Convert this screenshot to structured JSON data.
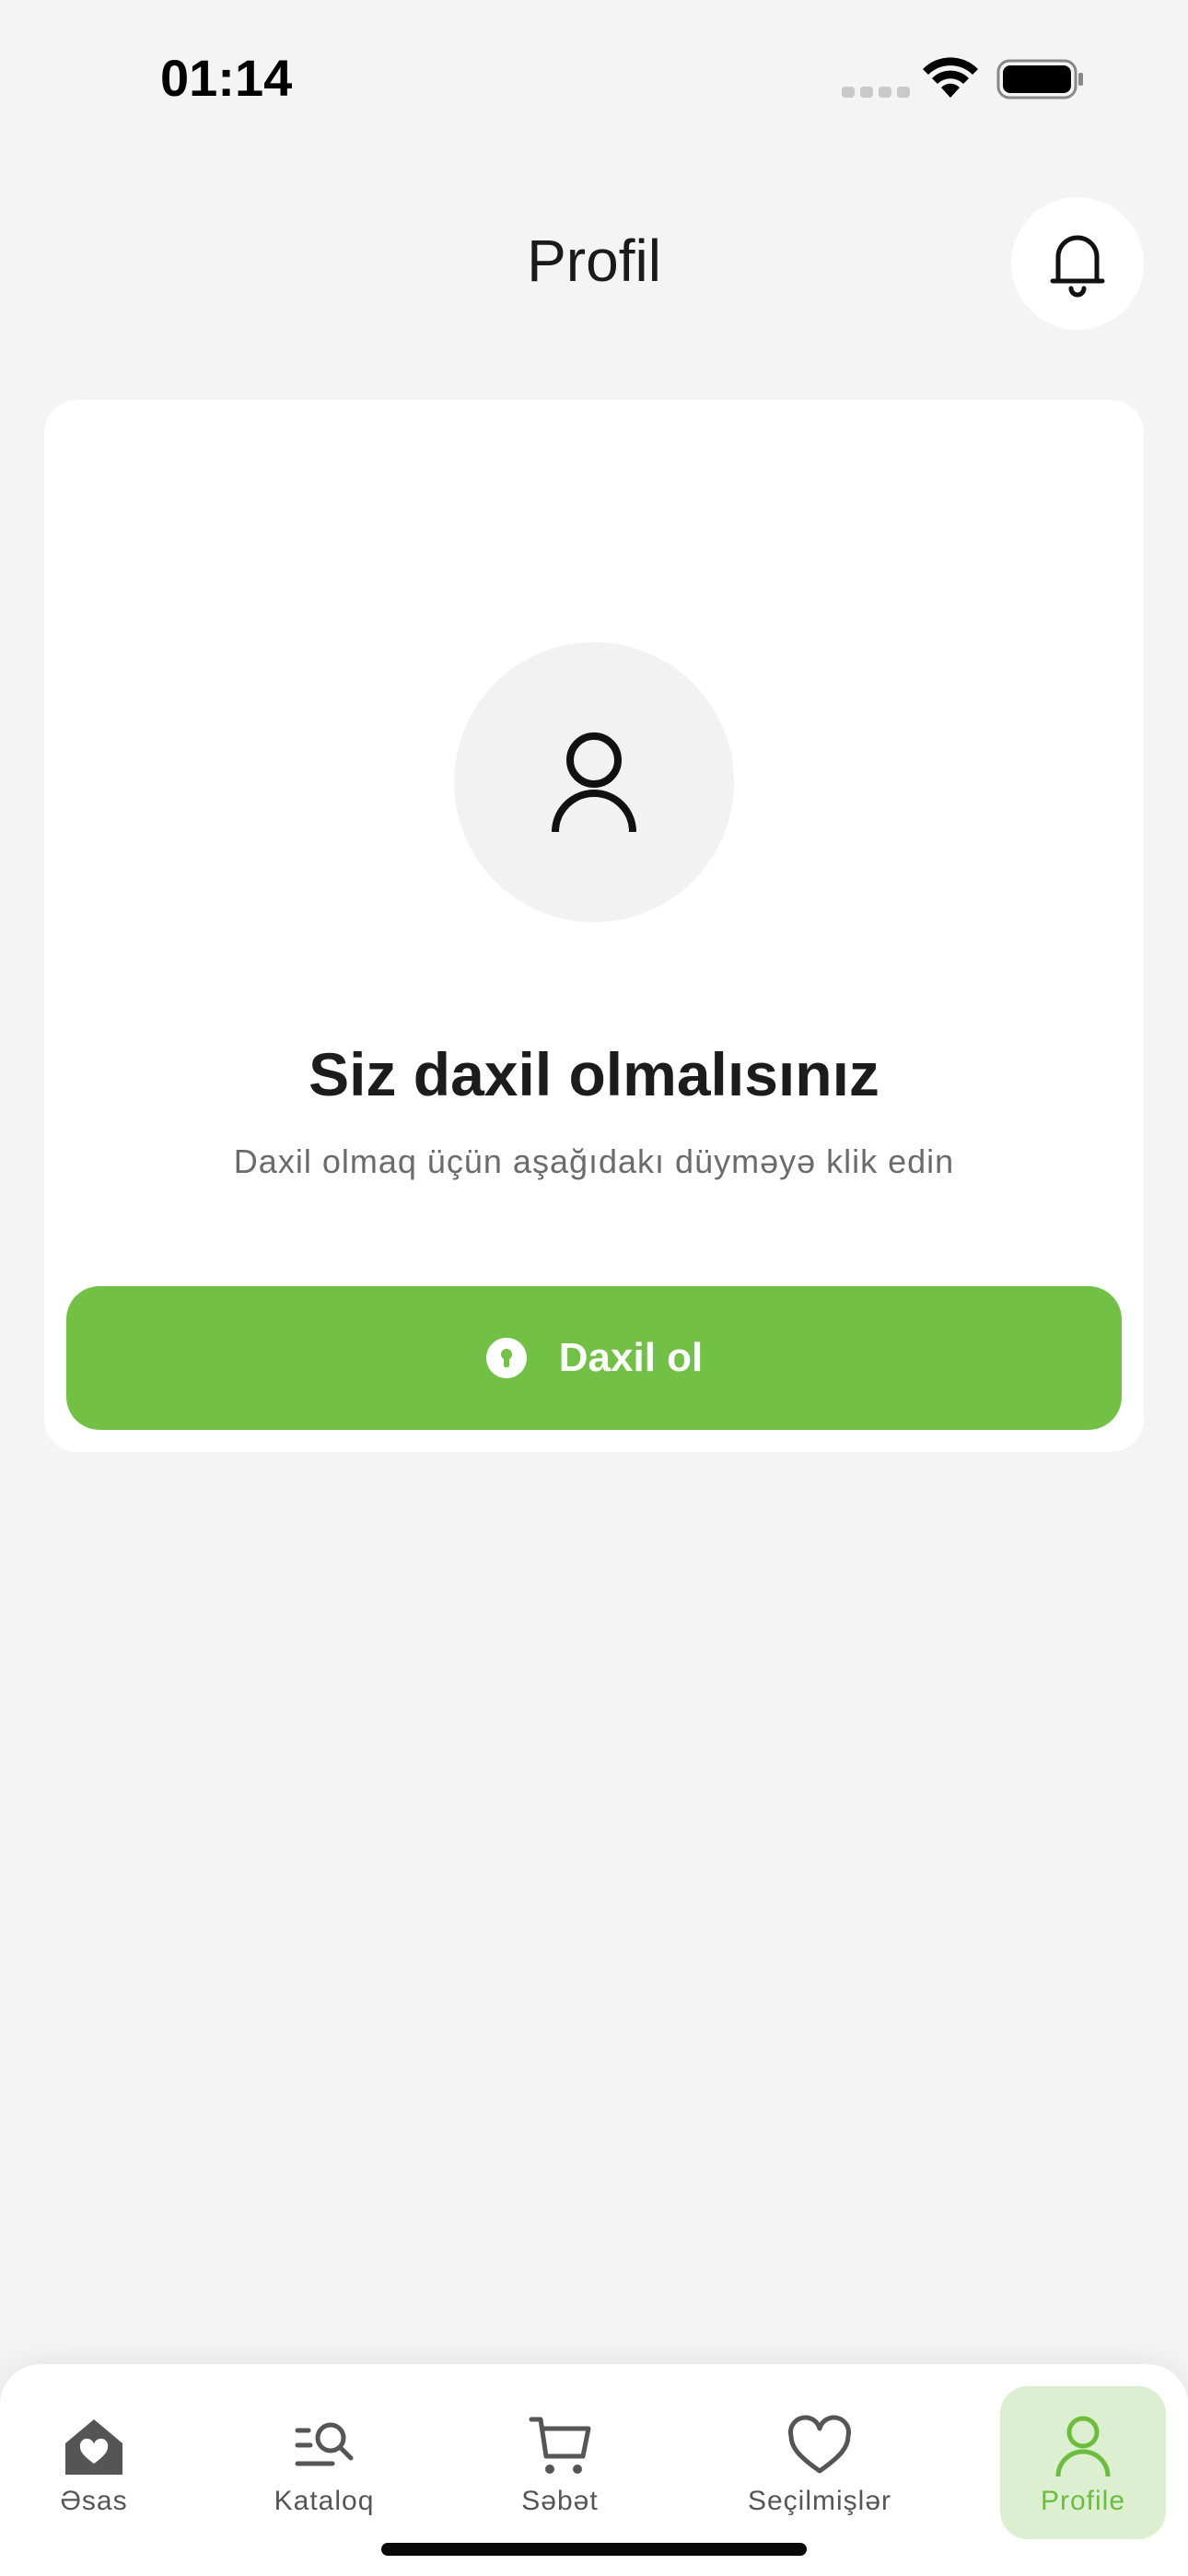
{
  "status_bar": {
    "time": "01:14",
    "icons": [
      "signal-dots-icon",
      "wifi-icon",
      "battery-icon"
    ]
  },
  "header": {
    "title": "Profil",
    "notification_icon": "bell-icon"
  },
  "card": {
    "avatar_icon": "user-icon",
    "title": "Siz daxil olmalısınız",
    "subtitle": "Daxil olmaq üçün aşağıdakı düyməyə klik edin",
    "login_button": {
      "label": "Daxil ol",
      "icon": "lock-circle-icon"
    }
  },
  "bottom_nav": {
    "items": [
      {
        "label": "Əsas",
        "icon": "home-heart-icon"
      },
      {
        "label": "Kataloq",
        "icon": "catalog-search-icon"
      },
      {
        "label": "Səbət",
        "icon": "cart-icon"
      },
      {
        "label": "Seçilmişlər",
        "icon": "heart-icon"
      },
      {
        "label": "Profile",
        "icon": "user-icon"
      }
    ],
    "active_index": 4
  },
  "colors": {
    "accent": "#72c045",
    "accent_light": "#dcefd0",
    "background": "#f4f4f4",
    "card": "#ffffff"
  }
}
